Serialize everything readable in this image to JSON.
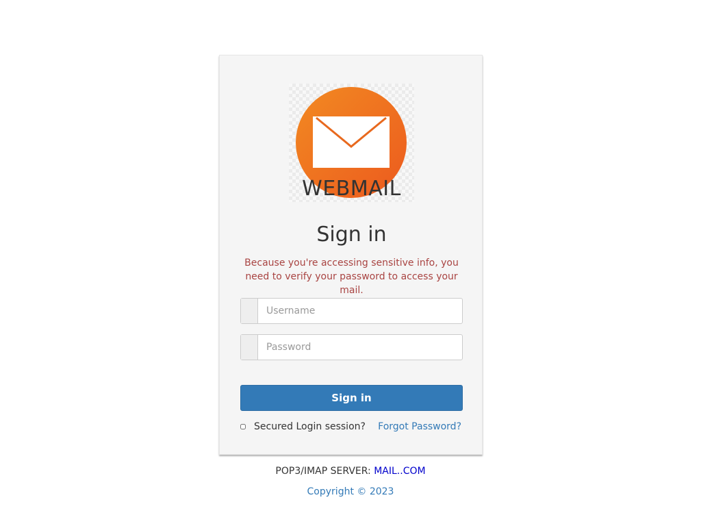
{
  "logo": {
    "text": "WEBMAIL",
    "icon": "envelope-icon",
    "circle_color": "#f07020"
  },
  "form": {
    "title": "Sign in",
    "warning": "Because you're accessing sensitive info, you need to verify your password to access your mail.",
    "username_placeholder": "Username",
    "password_placeholder": "Password",
    "signin_label": "Sign in",
    "secure_session_label": "Secured Login session?",
    "forgot_password_label": "Forgot Password?"
  },
  "footer": {
    "server_label": "POP3/IMAP SERVER:",
    "server_value": "MAIL..COM",
    "copyright": "Copyright © 2023"
  },
  "colors": {
    "primary": "#337ab7",
    "warning": "#a94442",
    "card_bg": "#f5f5f5"
  }
}
